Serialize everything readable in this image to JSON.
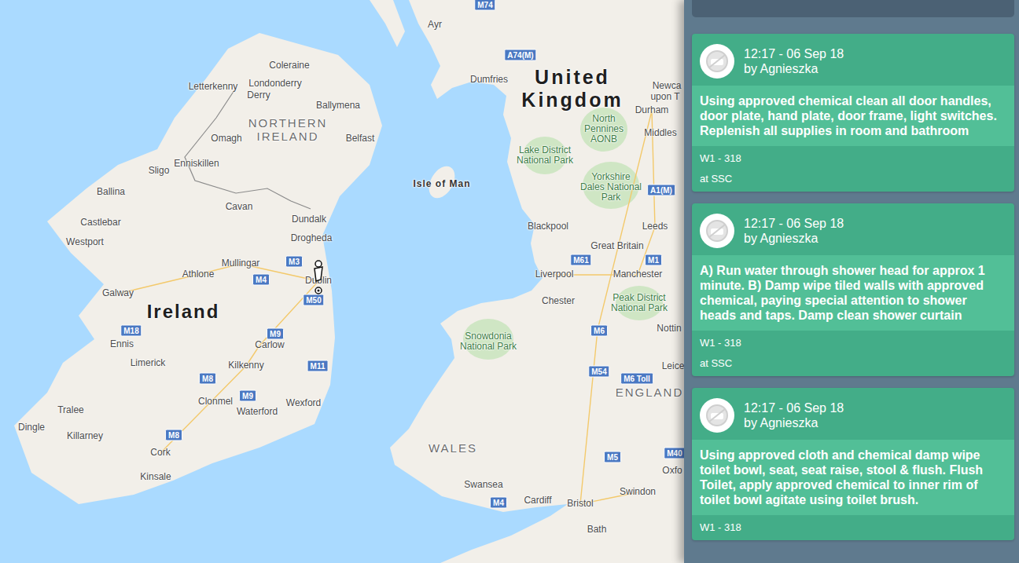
{
  "map": {
    "labels": [
      {
        "text": "Coleraine",
        "kind": "city"
      },
      {
        "text": "Letterkenny",
        "kind": "city"
      },
      {
        "text": "Londonderry",
        "kind": "city"
      },
      {
        "text": "Derry",
        "kind": "city"
      },
      {
        "text": "Ballymena",
        "kind": "city"
      },
      {
        "text": "NORTHERN IRELAND",
        "kind": "region"
      },
      {
        "text": "Belfast",
        "kind": "city"
      },
      {
        "text": "Omagh",
        "kind": "city"
      },
      {
        "text": "Enniskillen",
        "kind": "city"
      },
      {
        "text": "Sligo",
        "kind": "city"
      },
      {
        "text": "Ballina",
        "kind": "city"
      },
      {
        "text": "Cavan",
        "kind": "city"
      },
      {
        "text": "Dundalk",
        "kind": "city"
      },
      {
        "text": "Castlebar",
        "kind": "city"
      },
      {
        "text": "Drogheda",
        "kind": "city"
      },
      {
        "text": "Westport",
        "kind": "city"
      },
      {
        "text": "Mullingar",
        "kind": "city"
      },
      {
        "text": "M3",
        "kind": "road"
      },
      {
        "text": "M4",
        "kind": "road"
      },
      {
        "text": "Athlone",
        "kind": "city"
      },
      {
        "text": "Dublin",
        "kind": "city"
      },
      {
        "text": "M50",
        "kind": "road"
      },
      {
        "text": "Galway",
        "kind": "city"
      },
      {
        "text": "Ireland",
        "kind": "country"
      },
      {
        "text": "M9",
        "kind": "road"
      },
      {
        "text": "M18",
        "kind": "road"
      },
      {
        "text": "Ennis",
        "kind": "city"
      },
      {
        "text": "Carlow",
        "kind": "city"
      },
      {
        "text": "Limerick",
        "kind": "city"
      },
      {
        "text": "Kilkenny",
        "kind": "city"
      },
      {
        "text": "M11",
        "kind": "road"
      },
      {
        "text": "M8",
        "kind": "road"
      },
      {
        "text": "Clonmel",
        "kind": "city"
      },
      {
        "text": "M9",
        "kind": "road"
      },
      {
        "text": "Waterford",
        "kind": "city"
      },
      {
        "text": "Wexford",
        "kind": "city"
      },
      {
        "text": "Tralee",
        "kind": "city"
      },
      {
        "text": "Dingle",
        "kind": "city"
      },
      {
        "text": "Killarney",
        "kind": "city"
      },
      {
        "text": "M8",
        "kind": "road"
      },
      {
        "text": "Cork",
        "kind": "city"
      },
      {
        "text": "Kinsale",
        "kind": "city"
      },
      {
        "text": "Ayr",
        "kind": "city"
      },
      {
        "text": "M74",
        "kind": "road"
      },
      {
        "text": "A74(M)",
        "kind": "road"
      },
      {
        "text": "Dumfries",
        "kind": "city"
      },
      {
        "text": "United Kingdom",
        "kind": "big-country"
      },
      {
        "text": "Newca",
        "kind": "city"
      },
      {
        "text": "upon T",
        "kind": "city"
      },
      {
        "text": "Durham",
        "kind": "city"
      },
      {
        "text": "North Pennines AONB",
        "kind": "park"
      },
      {
        "text": "Middles",
        "kind": "city"
      },
      {
        "text": "Lake District National Park",
        "kind": "park"
      },
      {
        "text": "Yorkshire Dales National Park",
        "kind": "park"
      },
      {
        "text": "A1(M)",
        "kind": "road"
      },
      {
        "text": "Isle of Man",
        "kind": "island"
      },
      {
        "text": "Blackpool",
        "kind": "city"
      },
      {
        "text": "Leeds",
        "kind": "city"
      },
      {
        "text": "Great Britain",
        "kind": "city"
      },
      {
        "text": "M61",
        "kind": "road"
      },
      {
        "text": "M1",
        "kind": "road"
      },
      {
        "text": "Liverpool",
        "kind": "city"
      },
      {
        "text": "Manchester",
        "kind": "city"
      },
      {
        "text": "Peak District National Park",
        "kind": "park"
      },
      {
        "text": "Chester",
        "kind": "city"
      },
      {
        "text": "Snowdonia National Park",
        "kind": "park"
      },
      {
        "text": "M6",
        "kind": "road"
      },
      {
        "text": "Nottin",
        "kind": "city"
      },
      {
        "text": "M54",
        "kind": "road"
      },
      {
        "text": "M6 Toll",
        "kind": "road"
      },
      {
        "text": "Leice",
        "kind": "city"
      },
      {
        "text": "ENGLAND",
        "kind": "region"
      },
      {
        "text": "WALES",
        "kind": "region"
      },
      {
        "text": "Swansea",
        "kind": "city"
      },
      {
        "text": "M4",
        "kind": "road"
      },
      {
        "text": "Cardiff",
        "kind": "city"
      },
      {
        "text": "Bristol",
        "kind": "city"
      },
      {
        "text": "M5",
        "kind": "road"
      },
      {
        "text": "M40",
        "kind": "road"
      },
      {
        "text": "Swindon",
        "kind": "city"
      },
      {
        "text": "Oxfo",
        "kind": "city"
      },
      {
        "text": "Bath",
        "kind": "city"
      }
    ]
  },
  "feed": {
    "cards": [
      {
        "time": "12:17 - 06 Sep 18",
        "author": "by Agnieszka",
        "message": "Using approved chemical clean all door handles, door plate, hand plate, door frame, light switches. Replenish all supplies in room and bathroom",
        "room": "W1 - 318",
        "site": "at SSC"
      },
      {
        "time": "12:17 - 06 Sep 18",
        "author": "by Agnieszka",
        "message": "A) Run water through shower head for approx 1 minute. B) Damp wipe tiled walls with approved chemical, paying special attention to shower heads and taps. Damp clean shower curtain",
        "room": "W1 - 318",
        "site": "at SSC"
      },
      {
        "time": "12:17 - 06 Sep 18",
        "author": "by Agnieszka",
        "message": "Using approved cloth and chemical damp wipe toilet bowl, seat, seat raise, stool & flush. Flush Toilet, apply approved chemical to inner rim of toilet bowl agitate using toilet brush.",
        "room": "W1 - 318"
      }
    ]
  }
}
